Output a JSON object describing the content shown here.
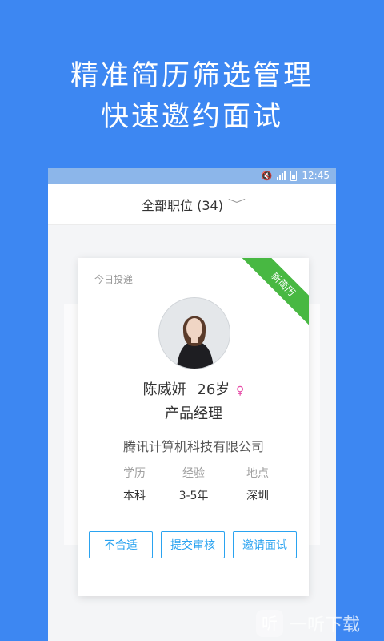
{
  "promo": {
    "line1": "精准简历筛选管理",
    "line2": "快速邀约面试"
  },
  "status_bar": {
    "time": "12:45",
    "icons": [
      "mute-icon",
      "signal-icon",
      "battery-icon"
    ]
  },
  "header": {
    "filter_label": "全部职位 (34)",
    "chevron": "﹀"
  },
  "card": {
    "section_label": "今日投递",
    "badge": "新简历",
    "candidate": {
      "name": "陈威妍",
      "age": "26岁",
      "gender_icon": "♀",
      "position": "产品经理",
      "company": "腾讯计算机科技有限公司",
      "details": [
        {
          "label": "学历",
          "value": "本科"
        },
        {
          "label": "经验",
          "value": "3-5年"
        },
        {
          "label": "地点",
          "value": "深圳"
        }
      ]
    },
    "actions": {
      "reject": "不合适",
      "submit": "提交审核",
      "invite": "邀请面试"
    }
  },
  "watermark": {
    "logo": "听",
    "text": "一听下载"
  },
  "colors": {
    "background": "#3d87f2",
    "accent": "#2aa3f0",
    "badge": "#48b842",
    "female": "#e64ea8"
  }
}
